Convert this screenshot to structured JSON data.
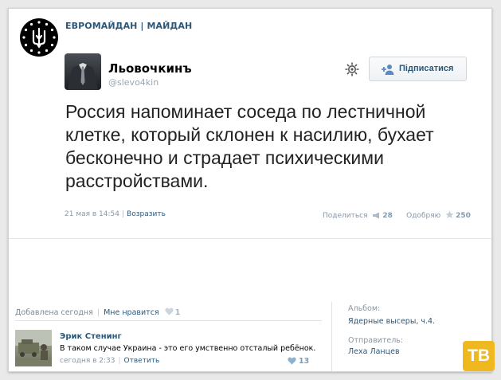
{
  "group": {
    "name": "ЕВРОМАЙДАН | МАЙДАН",
    "avatar_icon": "trident-stars-logo"
  },
  "tweet": {
    "author_name": "Льовочкинъ",
    "author_handle": "@slevo4kin",
    "follow_label": "Підписатися",
    "text": "Россия напоминает соседа по лестничной клетке, который склонен к насилию, бухает бесконечно и страдает психическими расстройствами.",
    "date": "21 мая в 14:54",
    "reply_label": "Возразить",
    "share_label": "Поделиться",
    "share_count": "28",
    "approve_label": "Одобряю",
    "approve_count": "250"
  },
  "footer": {
    "added_label": "Добавлена сегодня",
    "like_label": "Мне нравится",
    "like_count": "1"
  },
  "comment": {
    "author": "Эрик Стенинг",
    "text": "В таком случае Украина - это его умственно отсталый ребёнок.",
    "time": "сегодня в 2:33",
    "reply_label": "Ответить",
    "likes": "13"
  },
  "sidebar": {
    "album_label": "Альбом:",
    "album_name": "Ядерные высеры, ч.4.",
    "sender_label": "Отправитель:",
    "sender_name": "Леха Ланцев"
  },
  "watermark": "ТВ",
  "colors": {
    "link": "#2b587a",
    "muted": "#8a96a3",
    "badge": "#f0b81f"
  }
}
